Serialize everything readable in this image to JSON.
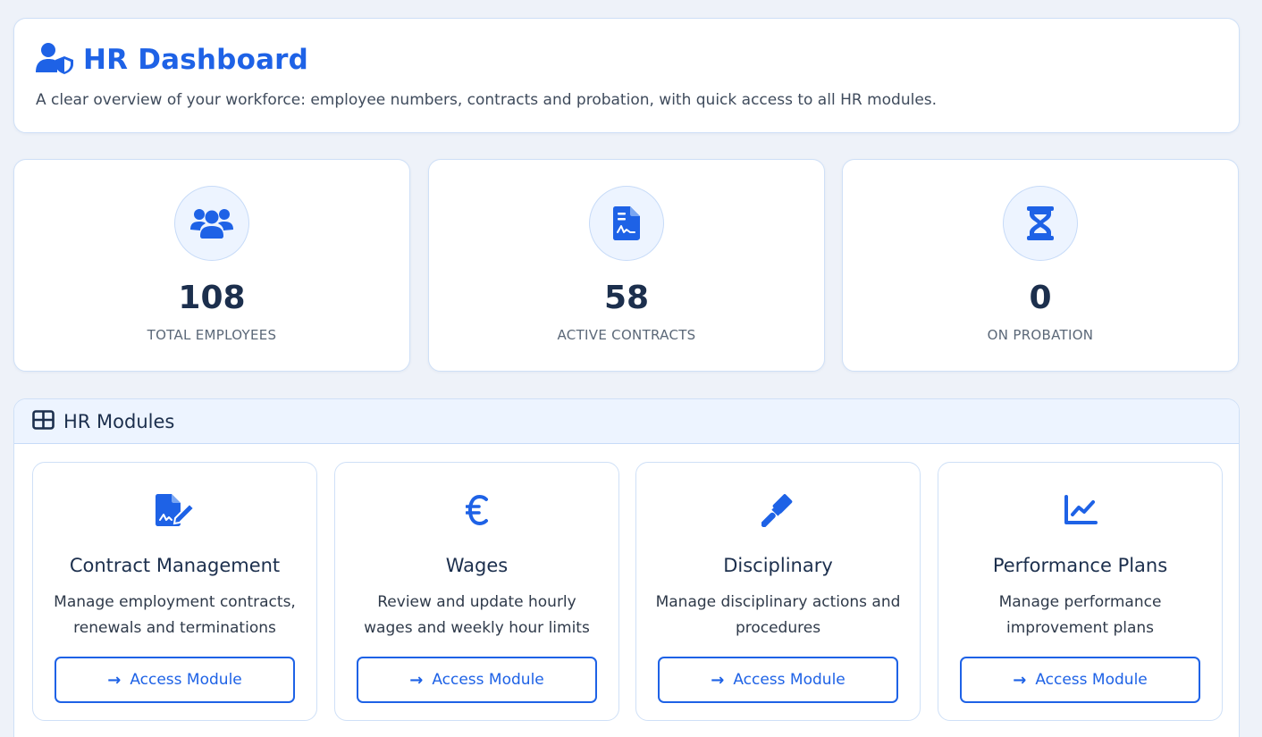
{
  "header": {
    "title": "HR Dashboard",
    "icon": "user-shield-icon",
    "subtitle": "A clear overview of your workforce: employee numbers, contracts and probation, with quick access to all HR modules."
  },
  "stats": [
    {
      "icon": "users-icon",
      "value": "108",
      "label": "TOTAL EMPLOYEES"
    },
    {
      "icon": "signed-contract-icon",
      "value": "58",
      "label": "ACTIVE CONTRACTS"
    },
    {
      "icon": "hourglass-icon",
      "value": "0",
      "label": "ON PROBATION"
    }
  ],
  "modules_panel": {
    "title": "HR Modules",
    "icon": "grid-icon"
  },
  "modules": [
    {
      "icon": "file-signature-icon",
      "name": "Contract Management",
      "description": "Manage employment contracts, renewals and terminations",
      "button": "Access Module"
    },
    {
      "icon": "euro-icon",
      "name": "Wages",
      "description": "Review and update hourly wages and weekly hour limits",
      "button": "Access Module"
    },
    {
      "icon": "gavel-icon",
      "name": "Disciplinary",
      "description": "Manage disciplinary actions and procedures",
      "button": "Access Module"
    },
    {
      "icon": "chart-line-icon",
      "name": "Performance Plans",
      "description": "Manage performance improvement plans",
      "button": "Access Module"
    }
  ],
  "colors": {
    "accent": "#1e62e6",
    "background": "#eef2f9",
    "card_border": "#cfe0f7",
    "icon_bg": "#edf4ff",
    "heading": "#1c2f4d"
  }
}
